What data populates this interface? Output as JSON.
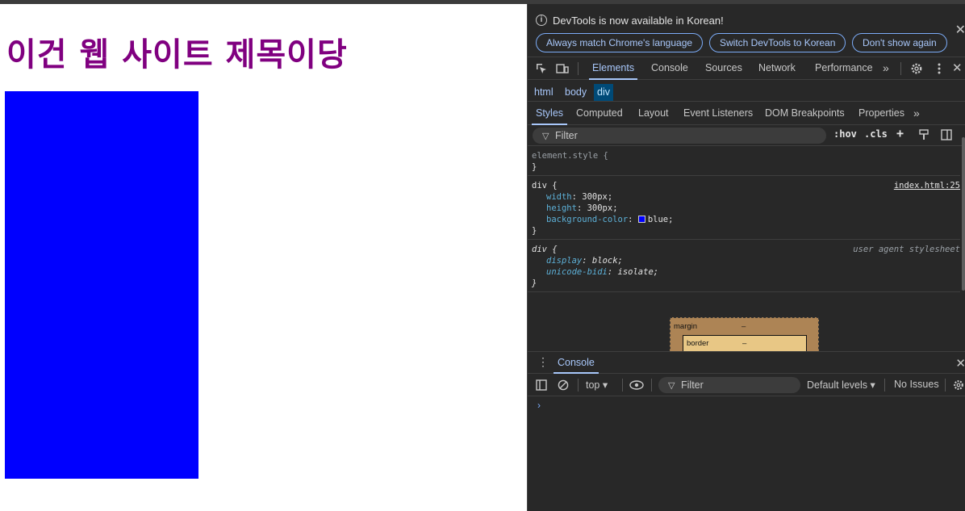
{
  "page": {
    "title": "이건 웹 사이트 제목이당"
  },
  "devtools": {
    "infobar": {
      "message": "DevTools is now available in Korean!",
      "btn_match": "Always match Chrome's language",
      "btn_switch": "Switch DevTools to Korean",
      "btn_dont_show": "Don't show again"
    },
    "tabs": {
      "elements": "Elements",
      "console": "Console",
      "sources": "Sources",
      "network": "Network",
      "performance": "Performance"
    },
    "breadcrumb": {
      "html": "html",
      "body": "body",
      "div": "div"
    },
    "subtabs": {
      "styles": "Styles",
      "computed": "Computed",
      "layout": "Layout",
      "event_listeners": "Event Listeners",
      "dom_breakpoints": "DOM Breakpoints",
      "properties": "Properties"
    },
    "filter": {
      "placeholder": "Filter",
      "hov": ":hov",
      "cls": ".cls"
    },
    "styles": {
      "element_style": "element.style {",
      "close": "}",
      "rule1_selector": "div {",
      "rule1_source": "index.html:25",
      "width_prop": "width",
      "width_val": "300px;",
      "height_prop": "height",
      "height_val": "300px;",
      "bg_prop": "background-color",
      "bg_val": "blue;",
      "rule2_selector": "div {",
      "rule2_source": "user agent stylesheet",
      "display_prop": "display",
      "display_val": "block;",
      "bidi_prop": "unicode-bidi",
      "bidi_val": "isolate;"
    },
    "boxmodel": {
      "margin_label": "margin",
      "margin_val": "–",
      "border_label": "border",
      "border_val": "–"
    },
    "console": {
      "tab": "Console",
      "context": "top",
      "filter_placeholder": "Filter",
      "levels": "Default levels",
      "issues": "No Issues",
      "prompt": "›"
    },
    "colors": {
      "accent": "#a8c7fa",
      "background": "#282828",
      "swatch": "#0000ff"
    }
  }
}
